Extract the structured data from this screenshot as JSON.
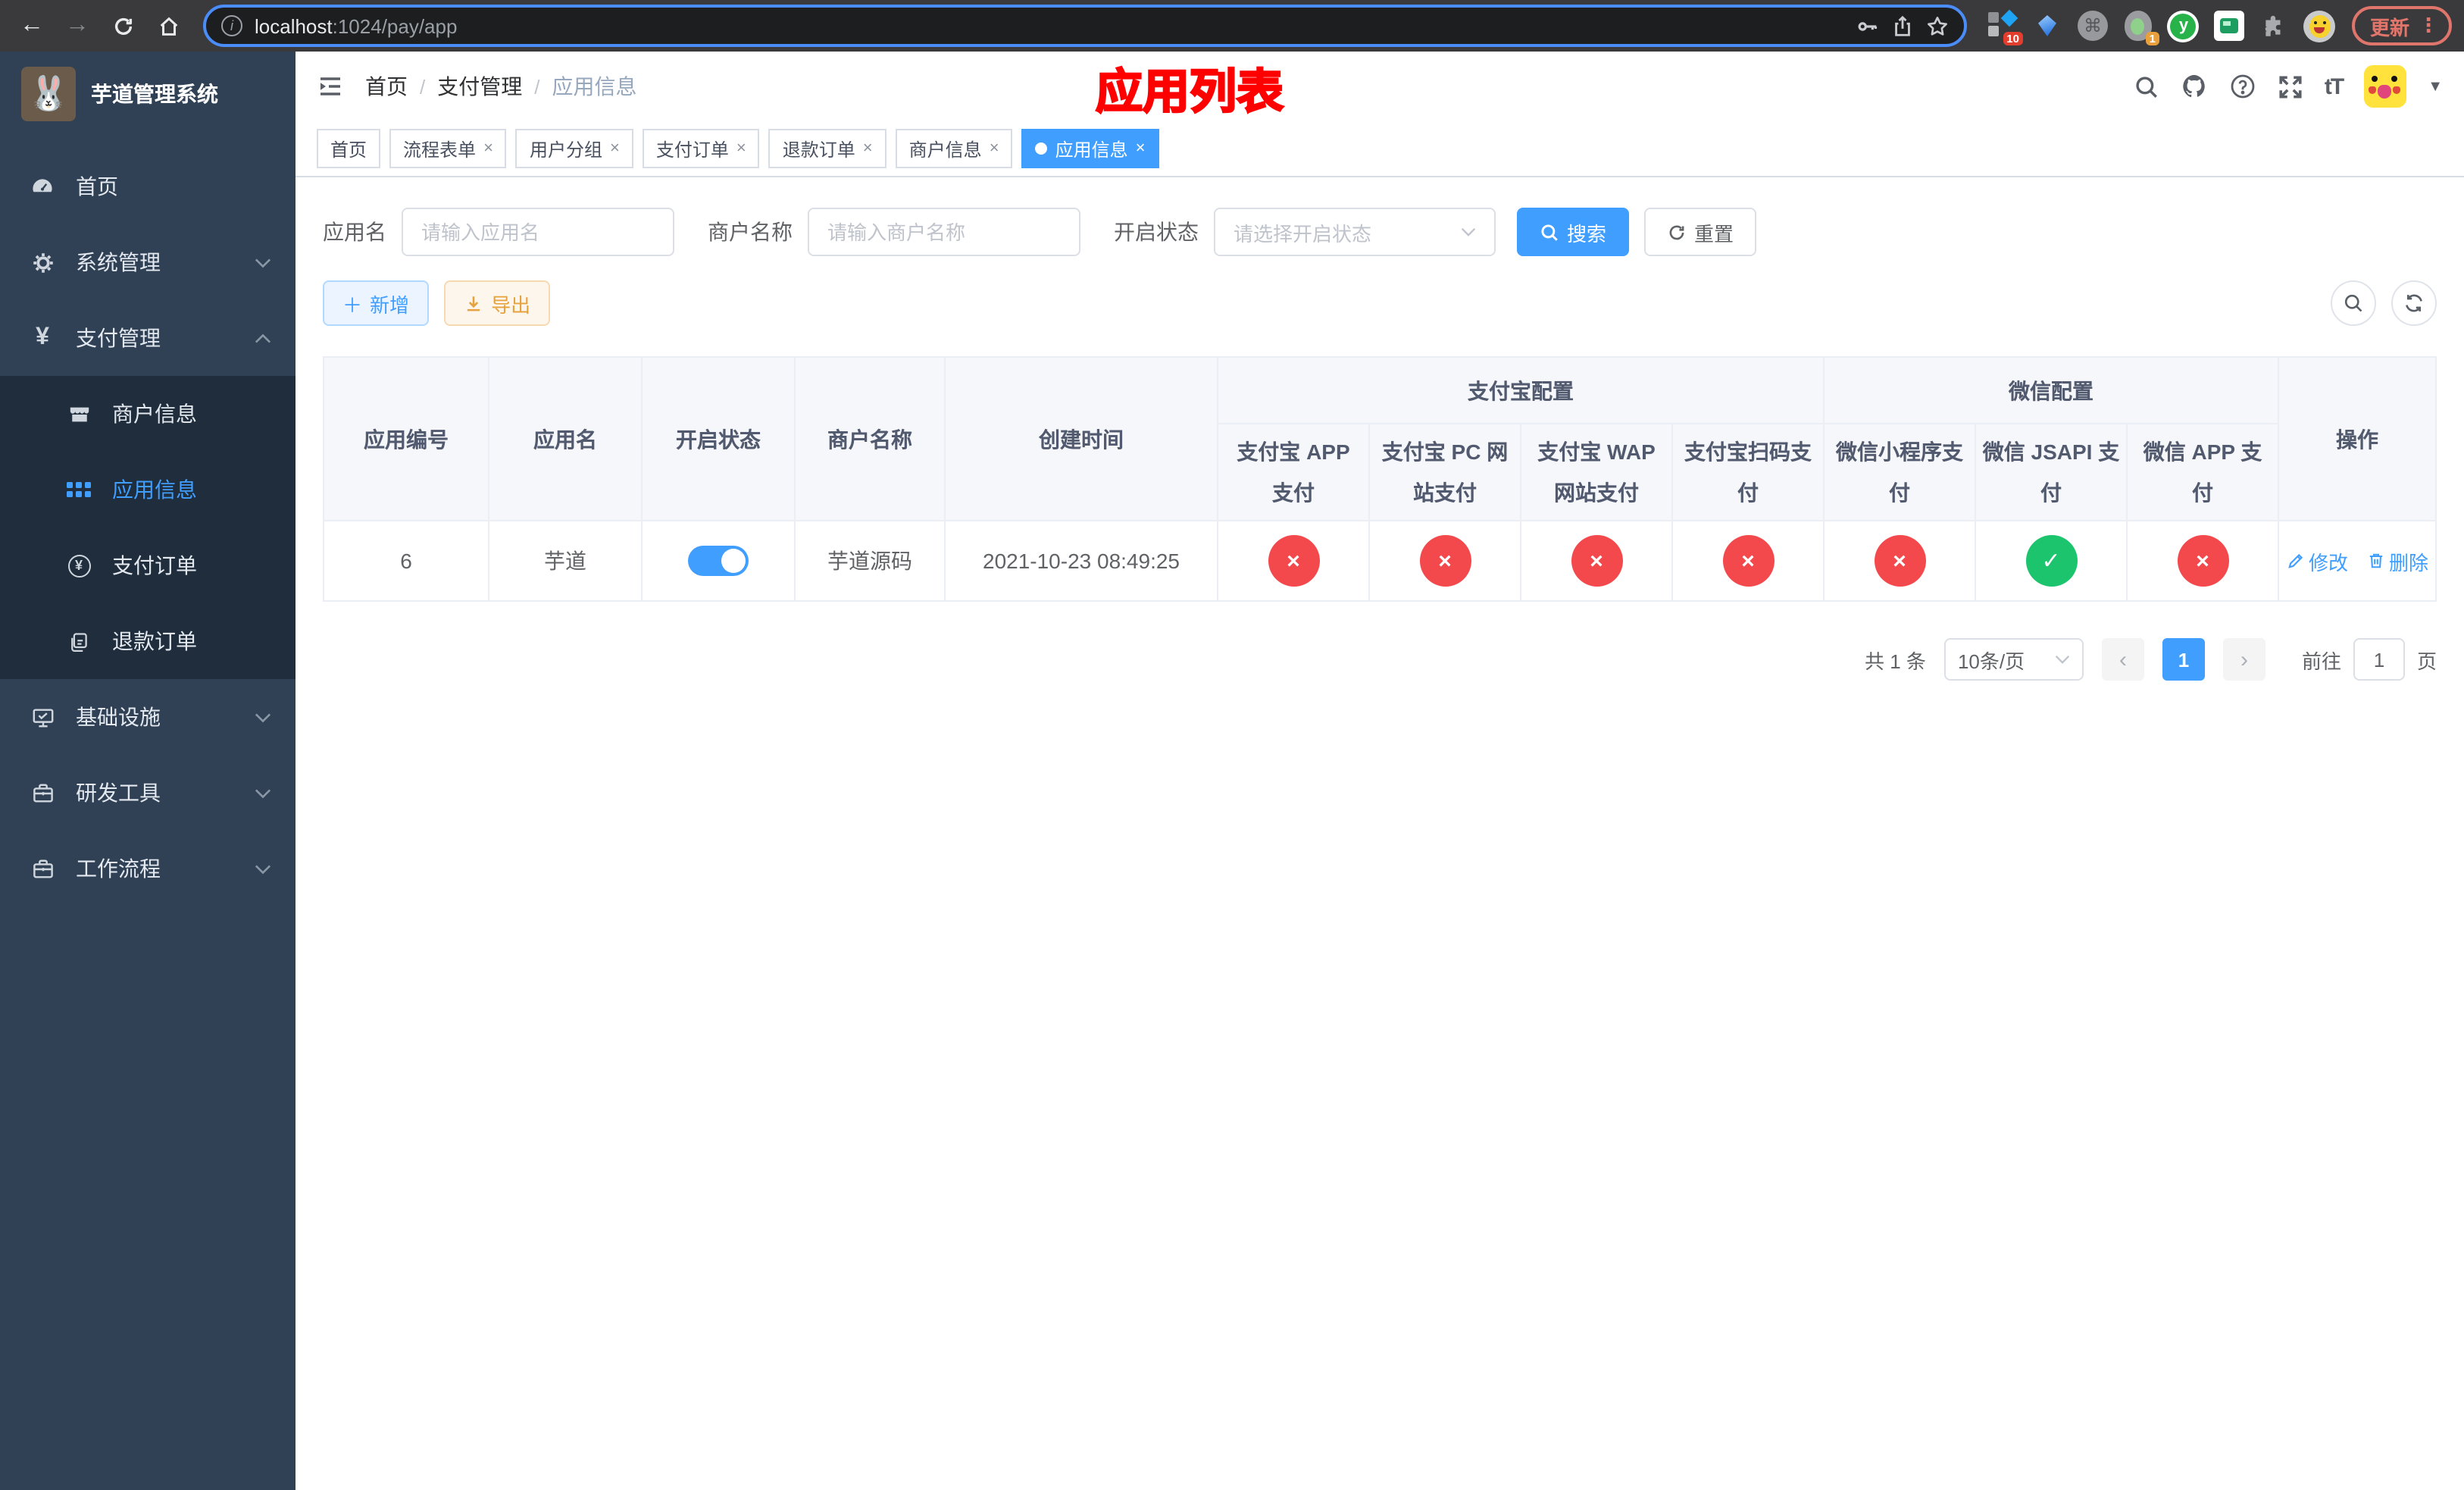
{
  "browser": {
    "url_host": "localhost",
    "url_path": ":1024/pay/app",
    "update_label": "更新",
    "ext_badge_blue_diamond": "10",
    "ext_badge_blob": "1",
    "ext_y_letter": "y"
  },
  "colors": {
    "accent": "#409eff",
    "danger": "#f4494c",
    "success": "#1dc46e",
    "sidebar_bg": "#304156",
    "submenu_bg": "#1f2d3d",
    "annotation": "#ff0000"
  },
  "sidebar": {
    "title": "芋道管理系统",
    "items": [
      {
        "label": "首页",
        "icon": "dashboard-icon"
      },
      {
        "label": "系统管理",
        "icon": "gear-icon"
      },
      {
        "label": "支付管理",
        "icon": "yen-icon"
      },
      {
        "label": "商户信息",
        "icon": "shop-icon"
      },
      {
        "label": "应用信息",
        "icon": "grid-icon"
      },
      {
        "label": "支付订单",
        "icon": "yen-circle-icon"
      },
      {
        "label": "退款订单",
        "icon": "refund-doc-icon"
      },
      {
        "label": "基础设施",
        "icon": "monitor-icon"
      },
      {
        "label": "研发工具",
        "icon": "briefcase-icon"
      },
      {
        "label": "工作流程",
        "icon": "briefcase-icon"
      }
    ]
  },
  "header": {
    "breadcrumb": [
      "首页",
      "支付管理",
      "应用信息"
    ],
    "annotation": "应用列表"
  },
  "tabs": [
    {
      "label": "首页"
    },
    {
      "label": "流程表单"
    },
    {
      "label": "用户分组"
    },
    {
      "label": "支付订单"
    },
    {
      "label": "退款订单"
    },
    {
      "label": "商户信息"
    },
    {
      "label": "应用信息"
    }
  ],
  "filters": {
    "app_name_label": "应用名",
    "app_name_placeholder": "请输入应用名",
    "merchant_label": "商户名称",
    "merchant_placeholder": "请输入商户名称",
    "status_label": "开启状态",
    "status_placeholder": "请选择开启状态",
    "search_label": "搜索",
    "reset_label": "重置"
  },
  "toolbar": {
    "add_label": "新增",
    "export_label": "导出"
  },
  "table": {
    "col_id": "应用编号",
    "col_name": "应用名",
    "col_status": "开启状态",
    "col_merchant": "商户名称",
    "col_created": "创建时间",
    "group_alipay": "支付宝配置",
    "group_wechat": "微信配置",
    "col_op": "操作",
    "pay_columns": [
      "支付宝 APP 支付",
      "支付宝 PC 网站支付",
      "支付宝 WAP 网站支付",
      "支付宝扫码支付",
      "微信小程序支付",
      "微信 JSAPI 支付",
      "微信 APP 支付"
    ],
    "flag_on_glyph": "✓",
    "flag_off_glyph": "×",
    "rows": [
      {
        "id": "6",
        "name": "芋道",
        "enabled": true,
        "merchant": "芋道源码",
        "created": "2021-10-23 08:49:25",
        "flags": [
          false,
          false,
          false,
          false,
          false,
          true,
          false
        ],
        "edit_label": "修改",
        "delete_label": "删除"
      }
    ]
  },
  "pagination": {
    "total": "共 1 条",
    "page_size": "10条/页",
    "current_page": "1",
    "goto_prefix": "前往",
    "goto_value": "1",
    "goto_suffix": "页"
  }
}
